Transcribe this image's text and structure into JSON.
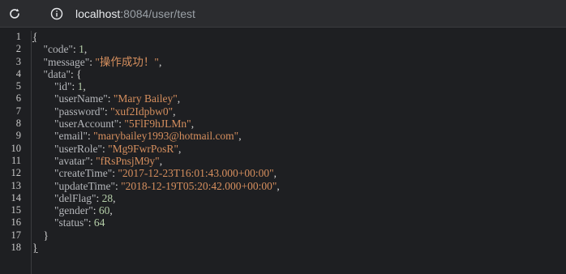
{
  "browser": {
    "url_host": "localhost",
    "url_rest": ":8084/user/test"
  },
  "lines": [
    {
      "num": "1",
      "indent": "",
      "key": null,
      "value": null,
      "vtype": null,
      "tail": "{"
    },
    {
      "num": "2",
      "indent": "    ",
      "key": "\"code\"",
      "value": "1",
      "vtype": "n",
      "tail": ","
    },
    {
      "num": "3",
      "indent": "    ",
      "key": "\"message\"",
      "value": "\"操作成功！\"",
      "vtype": "s",
      "tail": ","
    },
    {
      "num": "4",
      "indent": "    ",
      "key": "\"data\"",
      "value": null,
      "vtype": null,
      "tail": "{"
    },
    {
      "num": "5",
      "indent": "        ",
      "key": "\"id\"",
      "value": "1",
      "vtype": "n",
      "tail": ","
    },
    {
      "num": "6",
      "indent": "        ",
      "key": "\"userName\"",
      "value": "\"Mary Bailey\"",
      "vtype": "s",
      "tail": ","
    },
    {
      "num": "7",
      "indent": "        ",
      "key": "\"password\"",
      "value": "\"xuf2Idpbw0\"",
      "vtype": "s",
      "tail": ","
    },
    {
      "num": "8",
      "indent": "        ",
      "key": "\"userAccount\"",
      "value": "\"5FlF9hJLMn\"",
      "vtype": "s",
      "tail": ","
    },
    {
      "num": "9",
      "indent": "        ",
      "key": "\"email\"",
      "value": "\"marybailey1993@hotmail.com\"",
      "vtype": "s",
      "tail": ","
    },
    {
      "num": "10",
      "indent": "        ",
      "key": "\"userRole\"",
      "value": "\"Mg9FwrPosR\"",
      "vtype": "s",
      "tail": ","
    },
    {
      "num": "11",
      "indent": "        ",
      "key": "\"avatar\"",
      "value": "\"fRsPnsjM9y\"",
      "vtype": "s",
      "tail": ","
    },
    {
      "num": "12",
      "indent": "        ",
      "key": "\"createTime\"",
      "value": "\"2017-12-23T16:01:43.000+00:00\"",
      "vtype": "s",
      "tail": ","
    },
    {
      "num": "13",
      "indent": "        ",
      "key": "\"updateTime\"",
      "value": "\"2018-12-19T05:20:42.000+00:00\"",
      "vtype": "s",
      "tail": ","
    },
    {
      "num": "14",
      "indent": "        ",
      "key": "\"delFlag\"",
      "value": "28",
      "vtype": "n",
      "tail": ","
    },
    {
      "num": "15",
      "indent": "        ",
      "key": "\"gender\"",
      "value": "60",
      "vtype": "n",
      "tail": ","
    },
    {
      "num": "16",
      "indent": "        ",
      "key": "\"status\"",
      "value": "64",
      "vtype": "n",
      "tail": ""
    },
    {
      "num": "17",
      "indent": "    ",
      "key": null,
      "value": null,
      "vtype": null,
      "tail": "}"
    },
    {
      "num": "18",
      "indent": "",
      "key": null,
      "value": null,
      "vtype": null,
      "tail": "}"
    }
  ]
}
